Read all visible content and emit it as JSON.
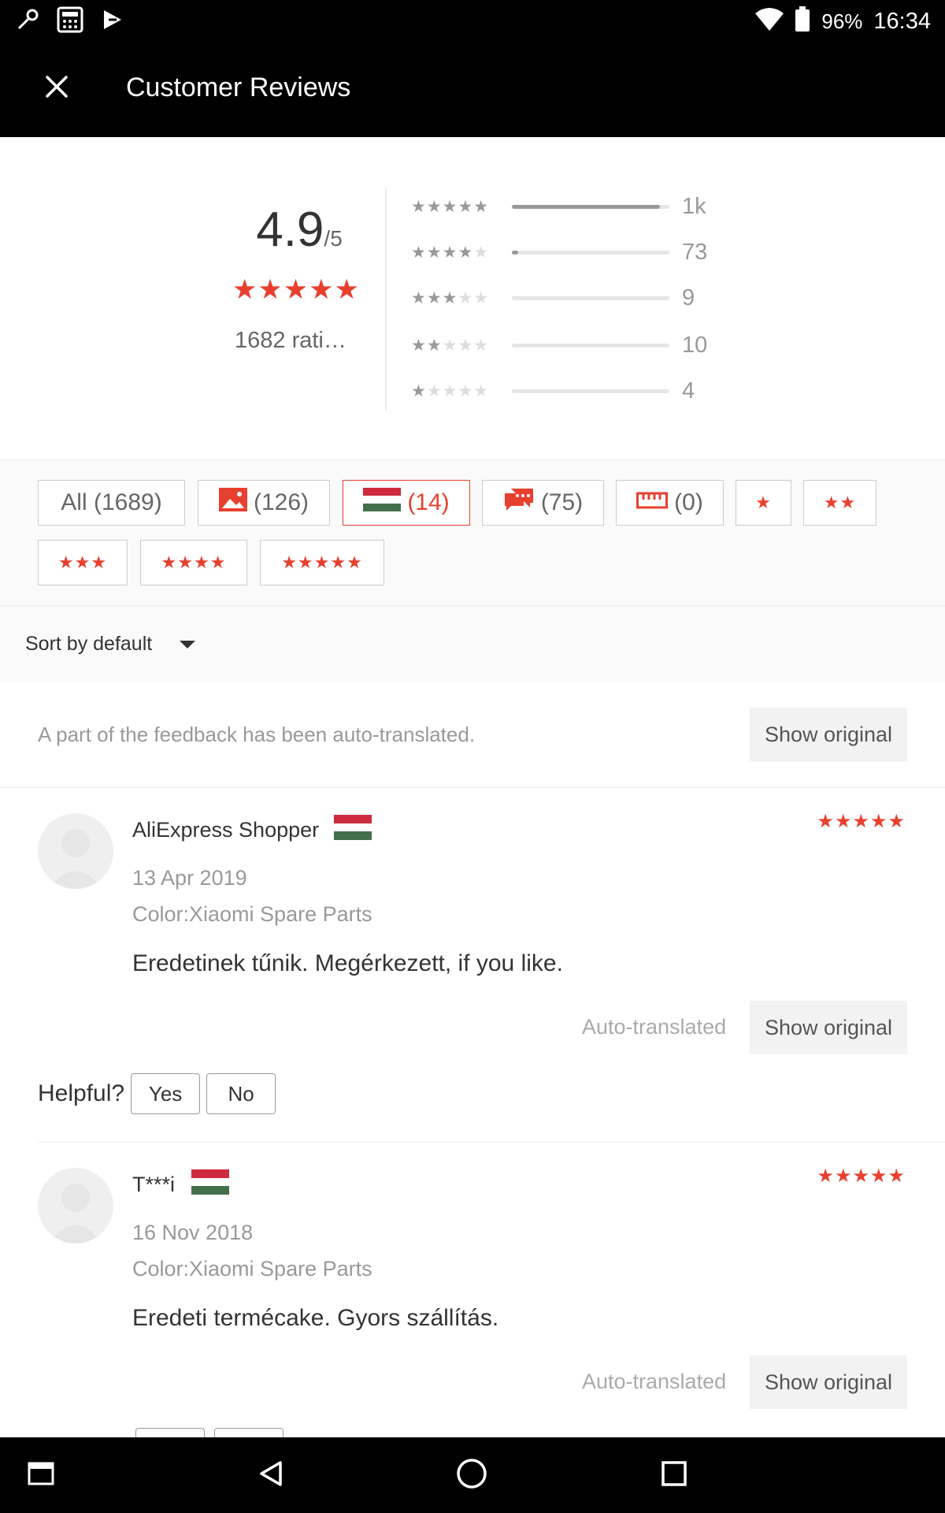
{
  "status_bar": {
    "battery": "96%",
    "time": "16:34"
  },
  "header": {
    "title": "Customer Reviews"
  },
  "summary": {
    "score": "4.9",
    "score_max": "/5",
    "stars": "★★★★★",
    "ratings_count": "1682 rati…",
    "distribution": [
      {
        "stars": 5,
        "count": "1k",
        "fraction": 0.94
      },
      {
        "stars": 4,
        "count": "73",
        "fraction": 0.04
      },
      {
        "stars": 3,
        "count": "9",
        "fraction": 0.0
      },
      {
        "stars": 2,
        "count": "10",
        "fraction": 0.0
      },
      {
        "stars": 1,
        "count": "4",
        "fraction": 0.0
      }
    ]
  },
  "filters": {
    "all": "All (1689)",
    "photos": "(126)",
    "country": "(14)",
    "comments": "(75)",
    "size": "(0)",
    "one_star": "★",
    "two_star": "★★",
    "three_star": "★★★",
    "four_star": "★★★★",
    "five_star": "★★★★★"
  },
  "sort": {
    "label": "Sort by default"
  },
  "notice": {
    "text": "A part of the feedback has been auto-translated.",
    "show_original": "Show original"
  },
  "reviews": [
    {
      "name": "AliExpress Shopper",
      "stars": "★★★★★",
      "date": "13 Apr 2019",
      "color": "Color:Xiaomi Spare Parts",
      "text": "Eredetinek tűnik. Megérkezett, if you like.",
      "auto_translated": "Auto-translated",
      "show_original": "Show original",
      "helpful": "Helpful?",
      "yes": "Yes",
      "no": "No"
    },
    {
      "name": "T***i",
      "stars": "★★★★★",
      "date": "16 Nov 2018",
      "color": "Color:Xiaomi Spare Parts",
      "text": "Eredeti termécake. Gyors szállítás.",
      "auto_translated": "Auto-translated",
      "show_original": "Show original"
    }
  ],
  "colors": {
    "accent": "#e8402f",
    "flag_red": "#cd2a3e",
    "flag_green": "#436f4d"
  }
}
